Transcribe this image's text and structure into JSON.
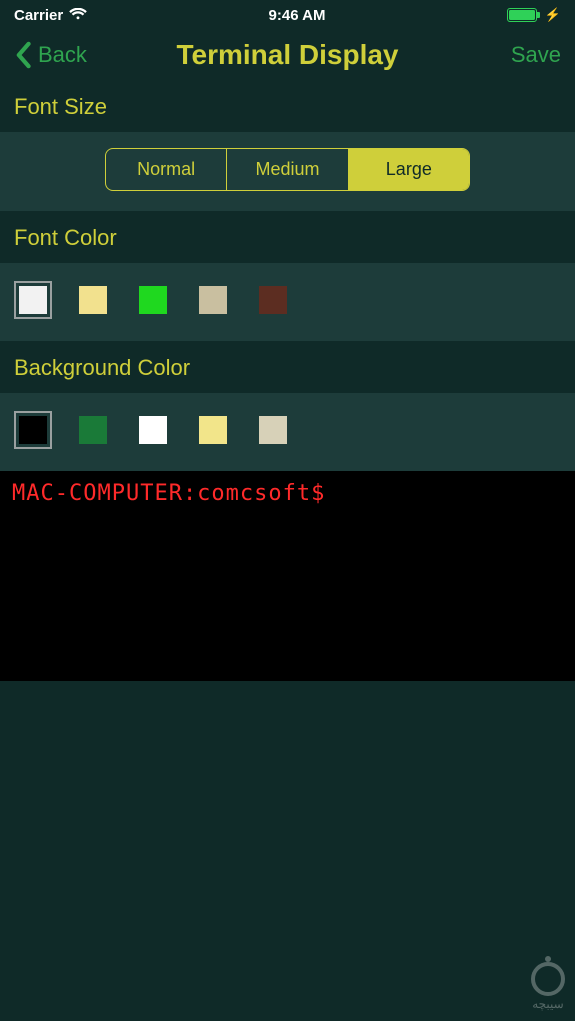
{
  "status_bar": {
    "carrier": "Carrier",
    "time": "9:46 AM"
  },
  "nav": {
    "back_label": "Back",
    "title": "Terminal Display",
    "save_label": "Save"
  },
  "sections": {
    "font_size": {
      "header": "Font Size",
      "options": [
        "Normal",
        "Medium",
        "Large"
      ],
      "selected_index": 2
    },
    "font_color": {
      "header": "Font Color",
      "swatches": [
        "#f2f2f2",
        "#f2e18e",
        "#1fd81f",
        "#c9bfa0",
        "#5c2d21"
      ],
      "selected_index": 0
    },
    "background_color": {
      "header": "Background Color",
      "swatches": [
        "#000000",
        "#1a7a38",
        "#ffffff",
        "#f2e58a",
        "#d7d1b8"
      ],
      "selected_index": 0
    }
  },
  "terminal_preview": {
    "prompt_text": "MAC-COMPUTER:comcsoft$"
  },
  "watermark": {
    "text": "سیبچه"
  }
}
